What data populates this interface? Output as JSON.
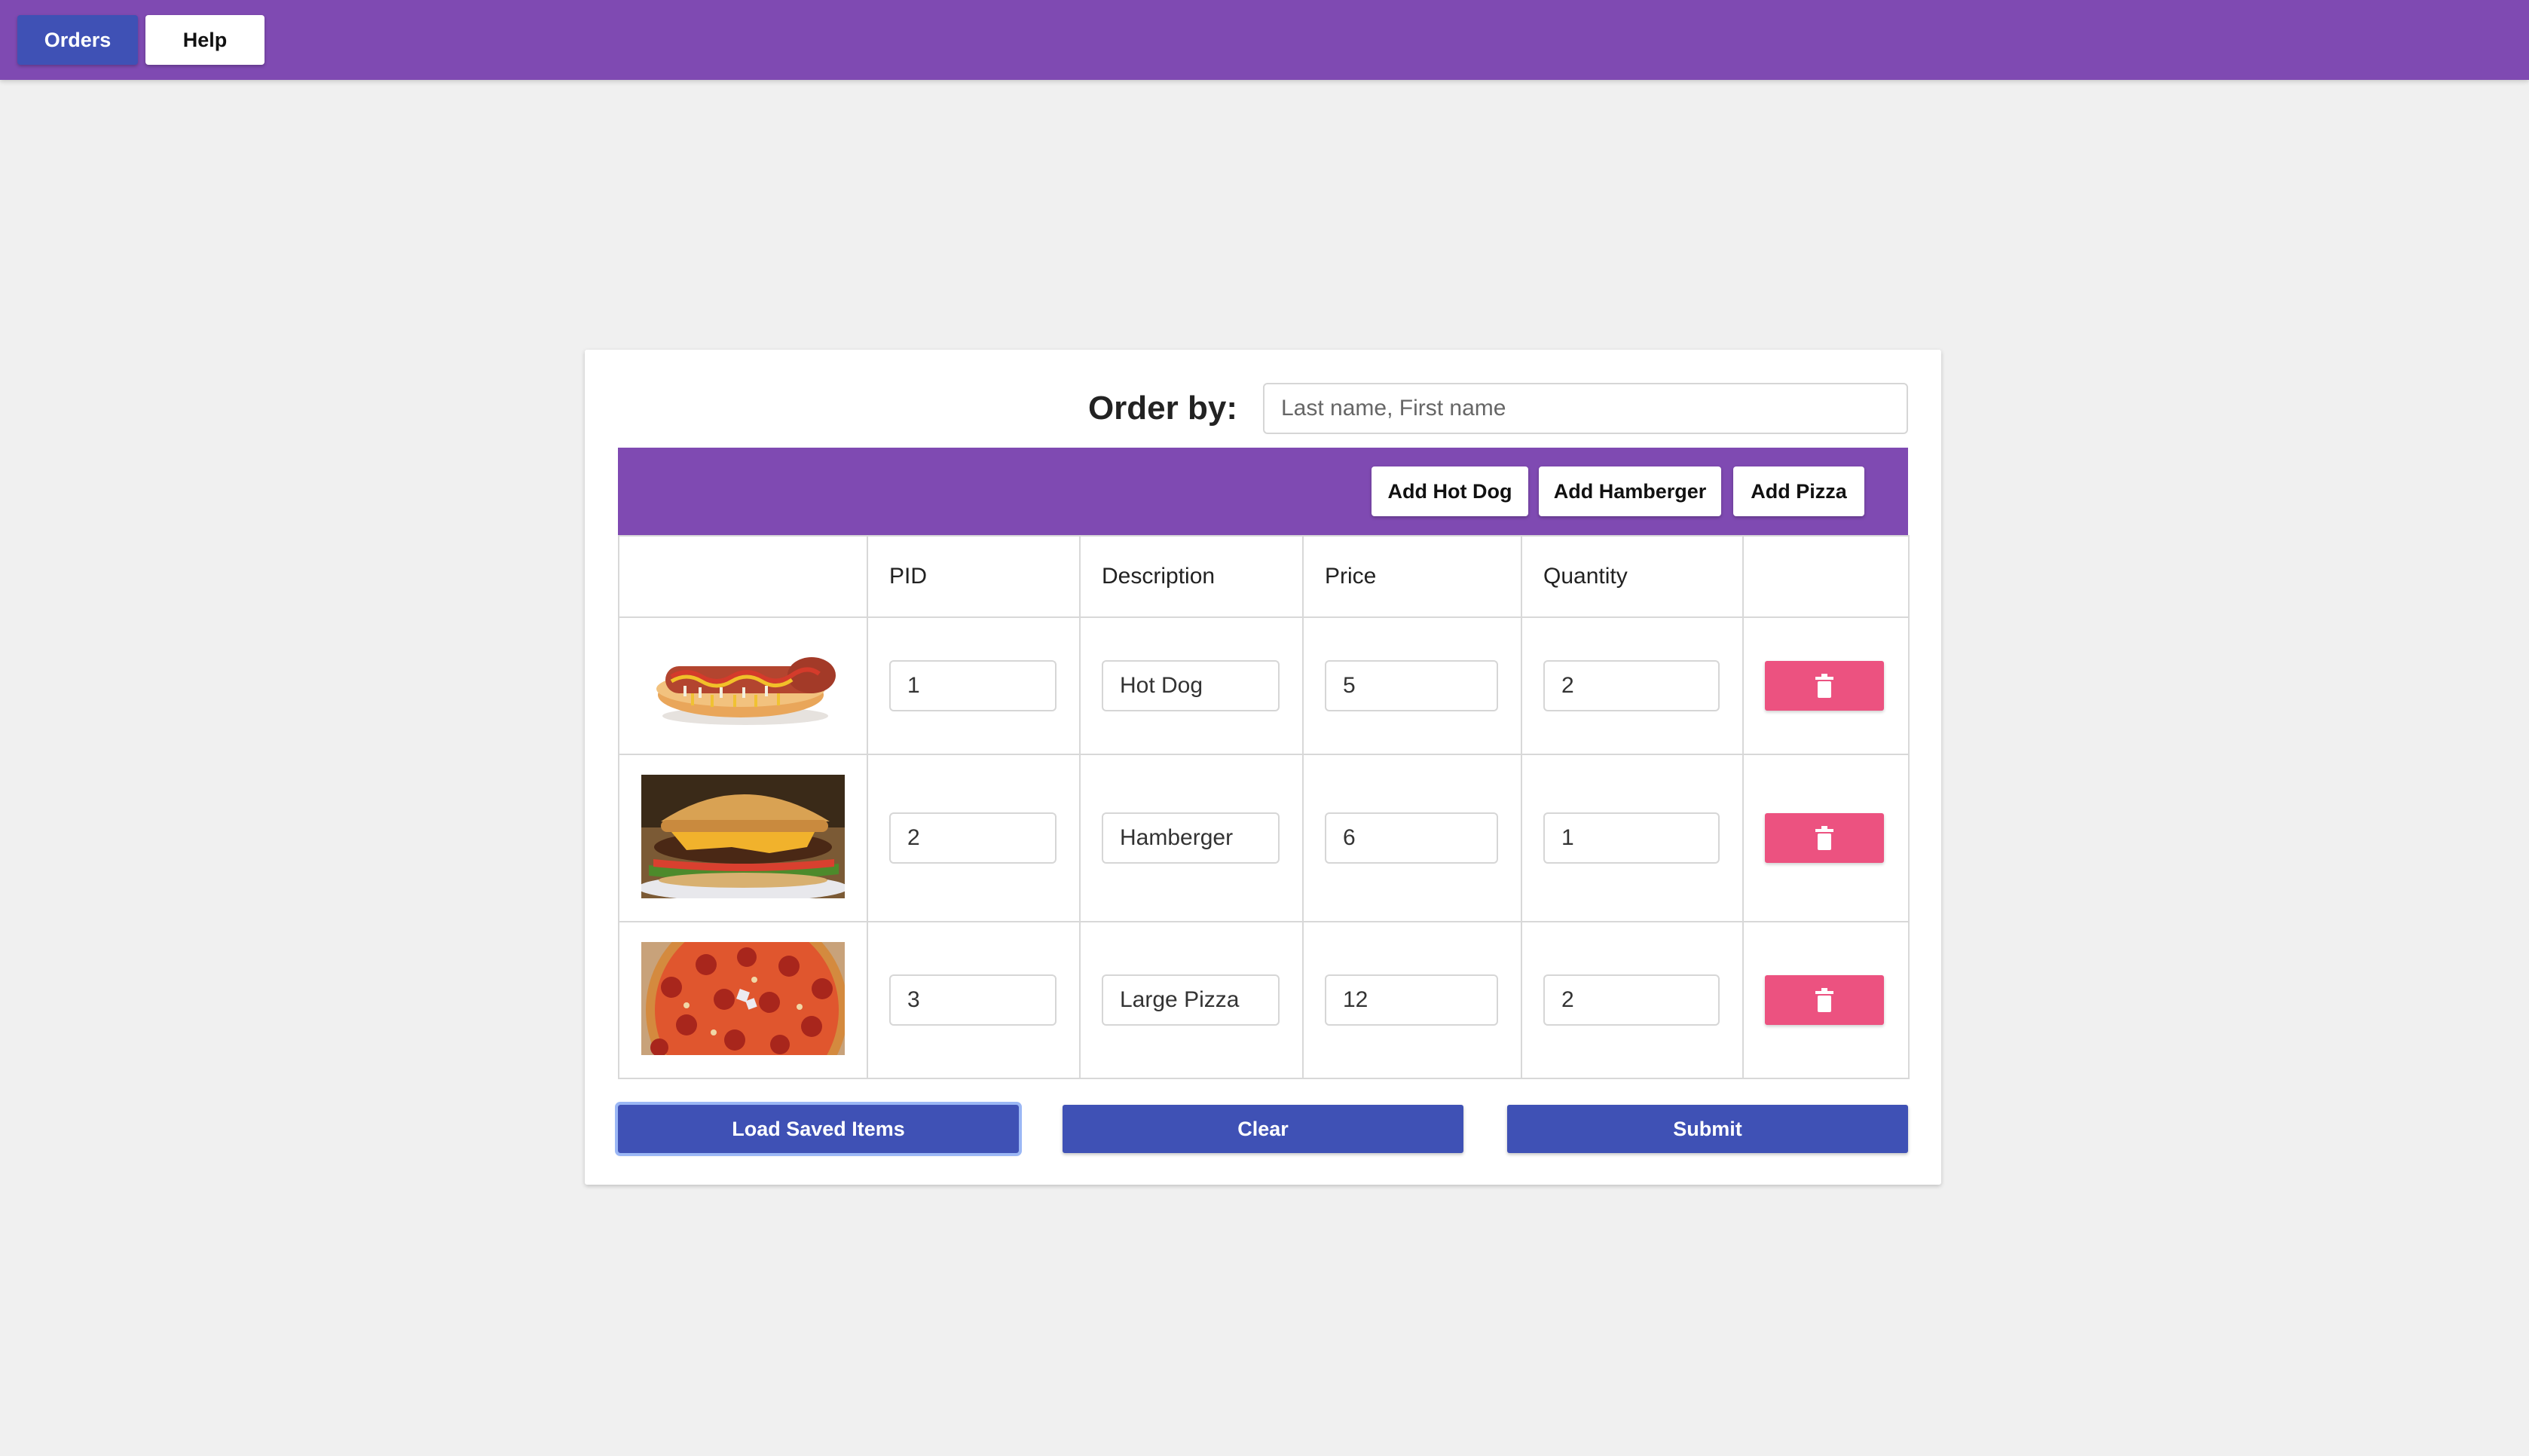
{
  "nav": {
    "orders_label": "Orders",
    "help_label": "Help",
    "accent": "#7f4ab2",
    "active_color": "#3f51b5"
  },
  "order_by": {
    "label": "Order by:",
    "placeholder": "Last name, First name",
    "value": ""
  },
  "toolbar": {
    "add_hot_dog": "Add Hot Dog",
    "add_hamberger": "Add Hamberger",
    "add_pizza": "Add Pizza"
  },
  "table": {
    "headers": [
      "",
      "PID",
      "Description",
      "Price",
      "Quantity",
      ""
    ],
    "rows": [
      {
        "image": "hot-dog-image",
        "pid": "1",
        "description": "Hot Dog",
        "price": "5",
        "quantity": "2",
        "delete_icon": "trash-icon"
      },
      {
        "image": "hamburger-image",
        "pid": "2",
        "description": "Hamberger",
        "price": "6",
        "quantity": "1",
        "delete_icon": "trash-icon"
      },
      {
        "image": "pizza-image",
        "pid": "3",
        "description": "Large Pizza",
        "price": "12",
        "quantity": "2",
        "delete_icon": "trash-icon"
      }
    ],
    "delete_color": "#ec5280"
  },
  "actions": {
    "load_label": "Load Saved Items",
    "clear_label": "Clear",
    "submit_label": "Submit"
  }
}
